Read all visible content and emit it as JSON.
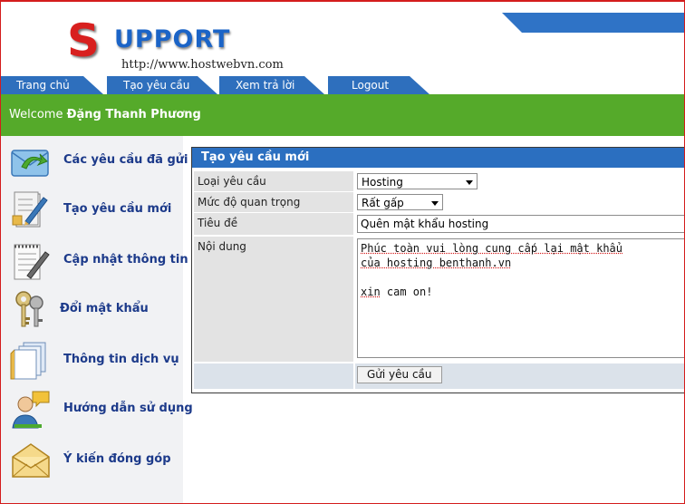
{
  "logo": {
    "letter": "S",
    "word": "UPPORT",
    "url": "http://www.hostwebvn.com"
  },
  "nav": {
    "tabs": [
      {
        "label": "Trang chủ"
      },
      {
        "label": "Tạo yêu cầu"
      },
      {
        "label": "Xem trả lời"
      },
      {
        "label": "Logout"
      }
    ]
  },
  "welcome": {
    "prefix": "Welcome",
    "user": "Đặng Thanh Phương"
  },
  "sidebar": {
    "items": [
      {
        "label": "Các yêu cầu đã gửi",
        "icon": "envelope-arrow-icon"
      },
      {
        "label": "Tạo yêu cầu mới",
        "icon": "pen-document-icon"
      },
      {
        "label": "Cập nhật thông tin",
        "icon": "notepad-pen-icon"
      },
      {
        "label": "Đổi mật khẩu",
        "icon": "keys-icon"
      },
      {
        "label": "Thông tin dịch vụ",
        "icon": "documents-icon"
      },
      {
        "label": "Hướng dẫn sử dụng",
        "icon": "support-person-icon"
      },
      {
        "label": "Ý kiến đóng góp",
        "icon": "mail-icon"
      }
    ]
  },
  "form": {
    "title": "Tạo yêu cầu mới",
    "request_type": {
      "label": "Loại yêu cầu",
      "value": "Hosting"
    },
    "priority": {
      "label": "Mức độ quan trọng",
      "value": "Rất gấp"
    },
    "subject": {
      "label": "Tiêu đề",
      "value": "Quên mật khẩu hosting"
    },
    "content": {
      "label": "Nội dung",
      "line1a": "Phúc toàn vui lòng cung cấp lại mật ",
      "line1b": "khẩu",
      "line2a": "của hosting ",
      "line2b": "benthanh.vn",
      "line4a": "xin",
      "line4b": " cam on!"
    },
    "submit": {
      "label": "Gửi yêu cầu"
    }
  },
  "colors": {
    "accent_blue": "#2e6fbd",
    "welcome_green": "#55aa2a",
    "logo_red": "#d8201f",
    "sidebar_text": "#1c3a8a"
  }
}
